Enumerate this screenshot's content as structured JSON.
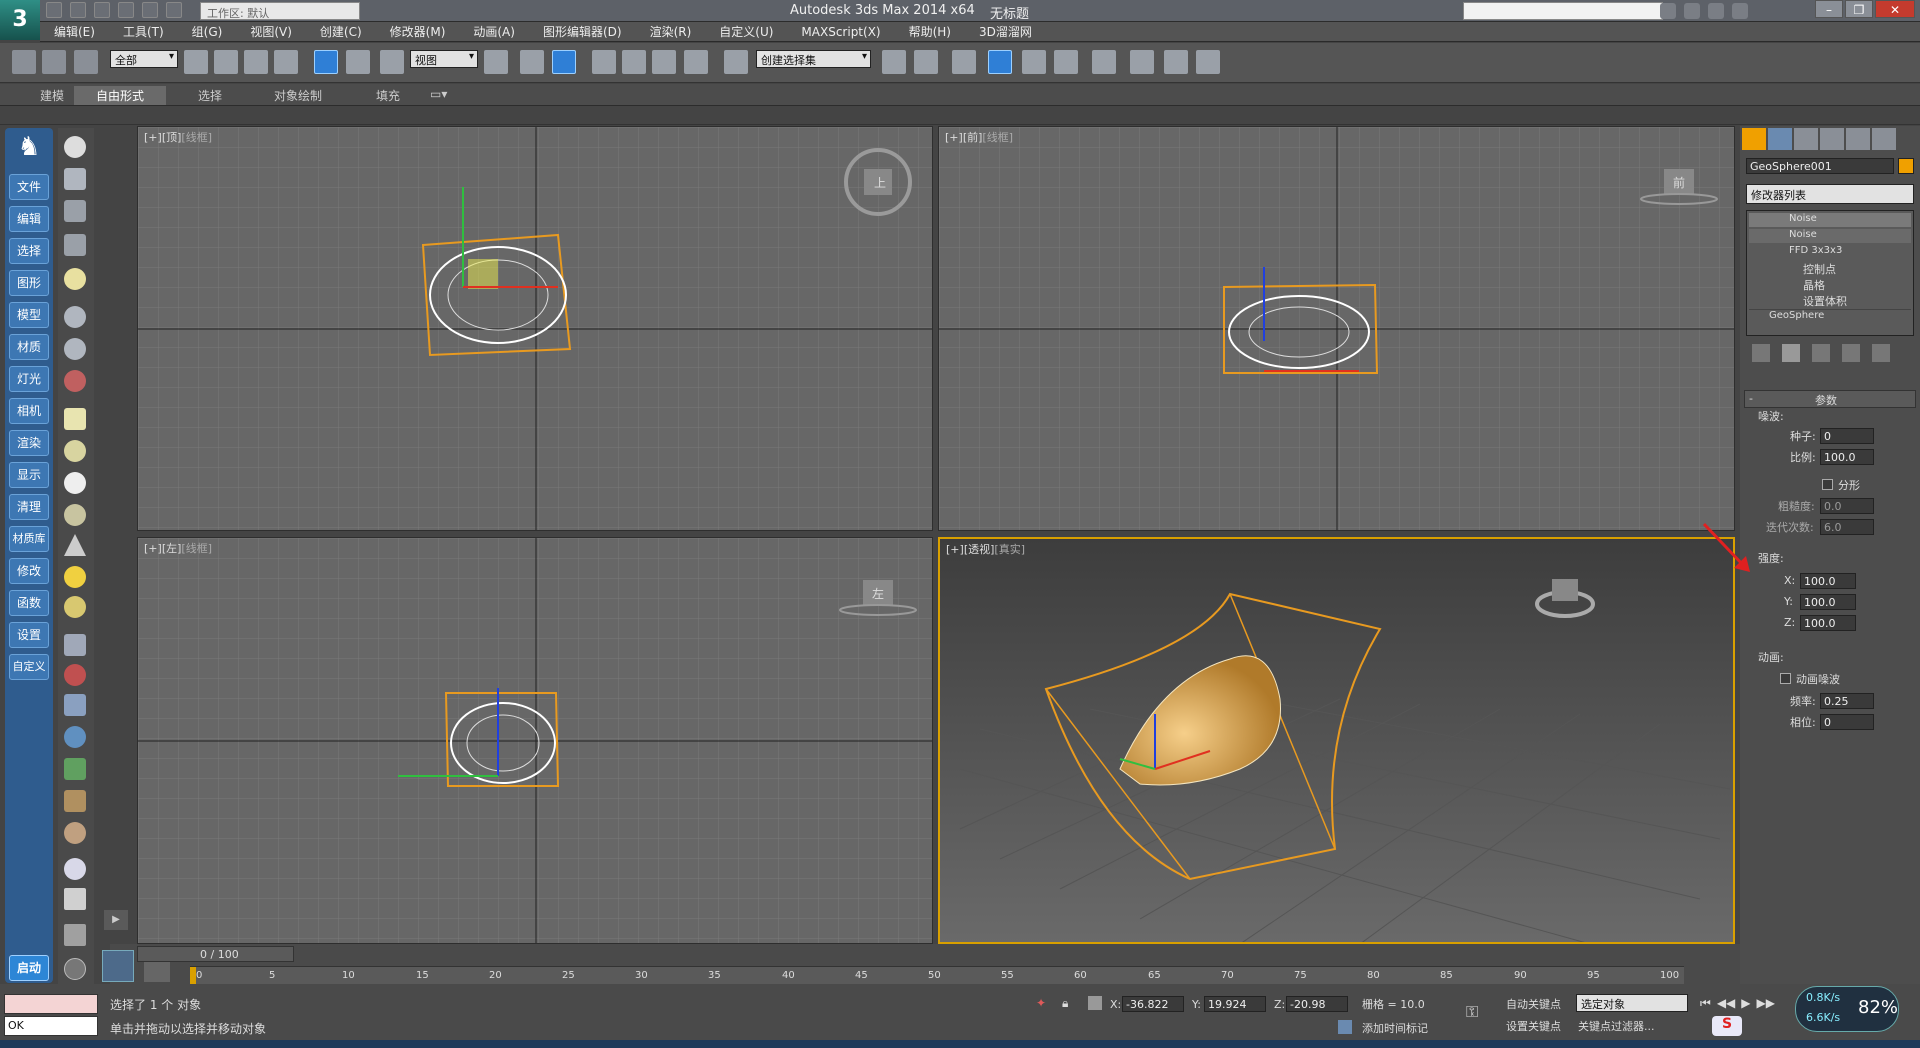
{
  "titlebar": {
    "app_title": "Autodesk 3ds Max  2014 x64",
    "doc_title": "无标题",
    "workspace": "工作区: 默认"
  },
  "menu": [
    "编辑(E)",
    "工具(T)",
    "组(G)",
    "视图(V)",
    "创建(C)",
    "修改器(M)",
    "动画(A)",
    "图形编辑器(D)",
    "渲染(R)",
    "自定义(U)",
    "MAXScript(X)",
    "帮助(H)",
    "3D溜溜网"
  ],
  "toolbar": {
    "filter": "全部",
    "ref_coord": "视图",
    "named_sel": "创建选择集"
  },
  "ribbon": {
    "tabs": [
      "建模",
      "自由形式",
      "选择",
      "对象绘制",
      "填充"
    ]
  },
  "leftnav": [
    "文件",
    "编辑",
    "选择",
    "图形",
    "模型",
    "材质",
    "灯光",
    "相机",
    "渲染",
    "显示",
    "清理",
    "材质库",
    "修改",
    "函数",
    "设置",
    "自定义"
  ],
  "start_label": "启动",
  "viewports": [
    {
      "label_plus": "[+]",
      "label_view": "[顶]",
      "label_mode": "[线框]",
      "cube": "上"
    },
    {
      "label_plus": "[+]",
      "label_view": "[前]",
      "label_mode": "[线框]",
      "cube": "前"
    },
    {
      "label_plus": "[+]",
      "label_view": "[左]",
      "label_mode": "[线框]",
      "cube": "左"
    },
    {
      "label_plus": "[+]",
      "label_view": "[透视]",
      "label_mode": "[真实]"
    }
  ],
  "command_panel": {
    "object_name": "GeoSphere001",
    "modifier_list": "修改器列表",
    "stack": [
      "Noise",
      "Noise",
      "FFD 3x3x3",
      "控制点",
      "晶格",
      "设置体积",
      "GeoSphere"
    ],
    "rollout_title": "参数",
    "noise_group": "噪波:",
    "seed_label": "种子:",
    "seed": "0",
    "scale_label": "比例:",
    "scale": "100.0",
    "fractal_label": "分形",
    "roughness_label": "粗糙度:",
    "roughness": "0.0",
    "iterations_label": "迭代次数:",
    "iterations": "6.0",
    "strength_group": "强度:",
    "x_label": "X:",
    "x": "100.0",
    "y_label": "Y:",
    "y": "100.0",
    "z_label": "Z:",
    "z": "100.0",
    "anim_group": "动画:",
    "anim_noise": "动画噪波",
    "freq_label": "频率:",
    "freq": "0.25",
    "phase_label": "相位:",
    "phase": "0"
  },
  "timeline": {
    "frame": "0 / 100",
    "ticks": [
      "0",
      "5",
      "10",
      "15",
      "20",
      "25",
      "30",
      "35",
      "40",
      "45",
      "50",
      "55",
      "60",
      "65",
      "70",
      "75",
      "80",
      "85",
      "90",
      "95",
      "100"
    ]
  },
  "status": {
    "maxscript": "OK",
    "selected": "选择了 1 个 对象",
    "prompt": "单击并拖动以选择并移动对象",
    "x_label": "X:",
    "x": "-36.822",
    "y_label": "Y:",
    "y": "19.924",
    "z_label": "Z:",
    "z": "-20.98",
    "grid": "栅格 = 10.0",
    "auto_key": "自动关键点",
    "set_key": "设置关键点",
    "sel_set": "选定对象",
    "key_filter": "关键点过滤器...",
    "add_tag": "添加时间标记"
  },
  "perf": {
    "percent": "82%",
    "up": "0.8K/s",
    "down": "6.6K/s"
  },
  "colors": {
    "accent": "#f0a000",
    "nav": "#2f5c8e",
    "viewport": "#676767"
  }
}
